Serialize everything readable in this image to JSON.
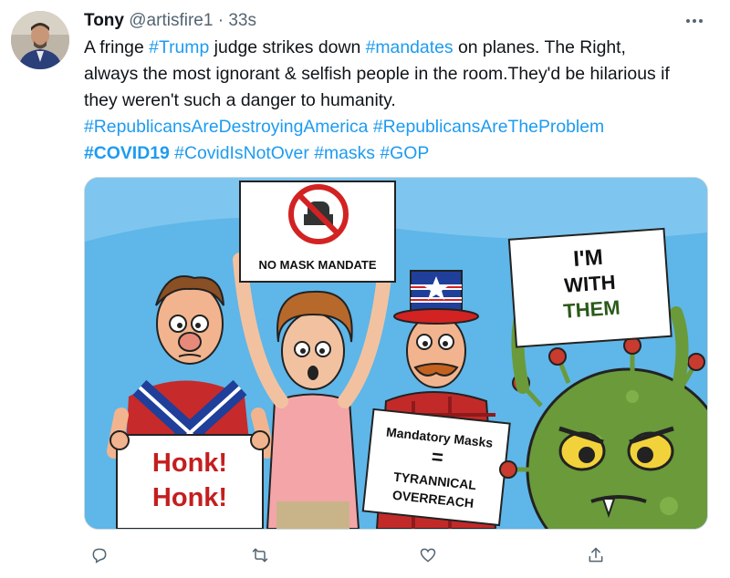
{
  "tweet": {
    "author_name": "Tony",
    "handle": "@artisfire1",
    "separator": "·",
    "time": "33s",
    "line1": {
      "pre": "A fringe ",
      "tag1": "#Trump",
      "mid": " judge strikes down ",
      "tag2": "#mandates",
      "post": " on planes. The Right,"
    },
    "line2": "always the most ignorant & selfish people in the room.They'd be hilarious if",
    "line3": "they weren't such a danger to humanity.",
    "hashtags_line4": [
      "#RepublicansAreDestroyingAmerica",
      "#RepublicansAreTheProblem"
    ],
    "hashtags_line5": [
      "#COVID19",
      "#CovidIsNotOver",
      "#masks",
      "#GOP"
    ]
  },
  "cartoon": {
    "sign_no_mask": "NO MASK MANDATE",
    "sign_honk_1": "Honk!",
    "sign_honk_2": "Honk!",
    "sign_mandatory_1": "Mandatory Masks",
    "sign_mandatory_eq": "=",
    "sign_mandatory_2": "TYRANNICAL",
    "sign_mandatory_3": "OVERREACH",
    "sign_with_1": "I'M",
    "sign_with_2": "WITH",
    "sign_with_3": "THEM"
  },
  "actions": {
    "icons": [
      "reply-icon",
      "retweet-icon",
      "like-icon",
      "share-icon"
    ]
  },
  "colors": {
    "link": "#1d9bf0",
    "text": "#0f1419",
    "secondary": "#536471",
    "sky": "#5fb6e8"
  }
}
